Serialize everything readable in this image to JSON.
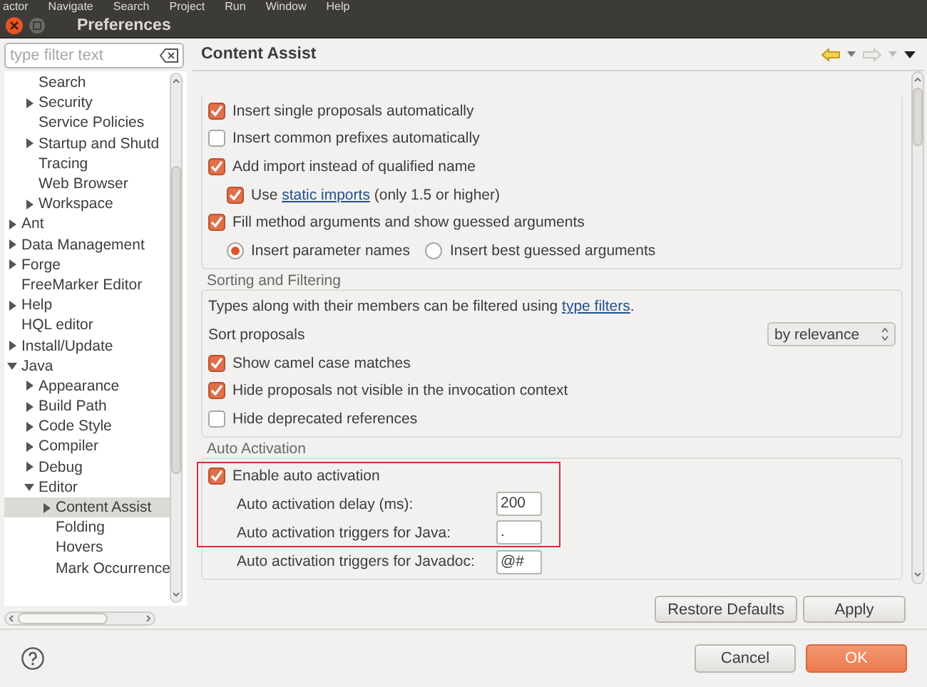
{
  "menu_bar": [
    "actor",
    "Navigate",
    "Search",
    "Project",
    "Run",
    "Window",
    "Help"
  ],
  "window": {
    "title": "Preferences"
  },
  "filter": {
    "placeholder": "type filter text"
  },
  "tree": {
    "continued_children": [
      {
        "label": "Search",
        "expandable": false,
        "selected": false
      },
      {
        "label": "Security",
        "expandable": true,
        "expanded": false,
        "selected": false
      },
      {
        "label": "Service Policies",
        "expandable": false,
        "selected": false
      },
      {
        "label": "Startup and Shutd",
        "expandable": true,
        "expanded": false,
        "selected": false
      },
      {
        "label": "Tracing",
        "expandable": false,
        "selected": false
      },
      {
        "label": "Web Browser",
        "expandable": false,
        "selected": false
      },
      {
        "label": "Workspace",
        "expandable": true,
        "expanded": false,
        "selected": false
      }
    ],
    "items": [
      {
        "label": "Ant",
        "expandable": true,
        "expanded": false,
        "selected": false
      },
      {
        "label": "Data Management",
        "expandable": true,
        "expanded": false,
        "selected": false
      },
      {
        "label": "Forge",
        "expandable": true,
        "expanded": false,
        "selected": false
      },
      {
        "label": "FreeMarker Editor",
        "expandable": false,
        "selected": false
      },
      {
        "label": "Help",
        "expandable": true,
        "expanded": false,
        "selected": false
      },
      {
        "label": "HQL editor",
        "expandable": false,
        "selected": false
      },
      {
        "label": "Install/Update",
        "expandable": true,
        "expanded": false,
        "selected": false
      },
      {
        "label": "Java",
        "expandable": true,
        "expanded": true,
        "selected": false,
        "children": [
          {
            "label": "Appearance",
            "expandable": true,
            "expanded": false,
            "selected": false
          },
          {
            "label": "Build Path",
            "expandable": true,
            "expanded": false,
            "selected": false
          },
          {
            "label": "Code Style",
            "expandable": true,
            "expanded": false,
            "selected": false
          },
          {
            "label": "Compiler",
            "expandable": true,
            "expanded": false,
            "selected": false
          },
          {
            "label": "Debug",
            "expandable": true,
            "expanded": false,
            "selected": false
          },
          {
            "label": "Editor",
            "expandable": true,
            "expanded": true,
            "selected": false,
            "children": [
              {
                "label": "Content Assist",
                "expandable": true,
                "expanded": false,
                "selected": true
              },
              {
                "label": "Folding",
                "expandable": false,
                "selected": false
              },
              {
                "label": "Hovers",
                "expandable": false,
                "selected": false
              },
              {
                "label": "Mark Occurrence",
                "expandable": false,
                "selected": false
              }
            ]
          }
        ]
      }
    ]
  },
  "page": {
    "title": "Content Assist",
    "sections": [
      {
        "rows": [
          {
            "kind": "checkbox",
            "label": "Insert single proposals automatically",
            "checked": true
          },
          {
            "kind": "checkbox",
            "label": "Insert common prefixes automatically",
            "checked": false
          },
          {
            "kind": "checkbox",
            "label": "Add import instead of qualified name",
            "checked": true,
            "children": [
              {
                "kind": "link-checkbox",
                "label_before": "Use",
                "link": "static imports",
                "label_after": "(only 1.5 or higher)",
                "checked": true
              }
            ]
          },
          {
            "kind": "checkbox",
            "label": "Fill method arguments and show guessed arguments",
            "checked": true
          },
          {
            "kind": "radios",
            "options": [
              {
                "label": "Insert parameter names",
                "selected": true
              },
              {
                "label": "Insert best guessed arguments",
                "selected": false
              }
            ]
          }
        ]
      },
      {
        "title": "Sorting and Filtering",
        "rows": [
          {
            "kind": "link-text",
            "label_before": "Types along with their members can be filtered using",
            "link": "type filters",
            "label_after": "."
          },
          {
            "kind": "select",
            "label": "Sort proposals",
            "value": "by relevance"
          },
          {
            "kind": "checkbox",
            "label": "Show camel case matches",
            "checked": true
          },
          {
            "kind": "checkbox",
            "label": "Hide proposals not visible in the invocation context",
            "checked": true
          },
          {
            "kind": "checkbox",
            "label": "Hide deprecated references",
            "checked": false
          }
        ]
      },
      {
        "title": "Auto Activation",
        "rows": [
          {
            "kind": "checkbox",
            "label": "Enable auto activation",
            "checked": true,
            "highlighted": true
          },
          {
            "kind": "field",
            "label": "Auto activation delay (ms):",
            "value": "200",
            "highlighted": true
          },
          {
            "kind": "field",
            "label": "Auto activation triggers for Java:",
            "value": ".",
            "highlighted": true
          },
          {
            "kind": "field",
            "label": "Auto activation triggers for Javadoc:",
            "value": "@#",
            "highlighted": false
          }
        ]
      }
    ],
    "buttons": [
      {
        "label": "Restore Defaults"
      },
      {
        "label": "Apply"
      }
    ]
  },
  "dialog_buttons": [
    {
      "label": "Cancel",
      "kind": "secondary"
    },
    {
      "label": "OK",
      "kind": "primary"
    }
  ]
}
